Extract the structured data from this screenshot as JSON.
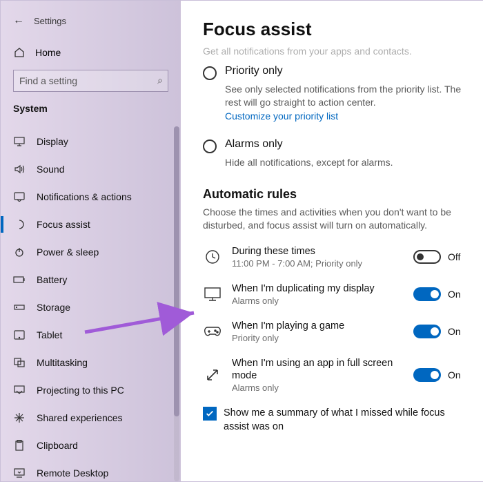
{
  "app": {
    "title": "Settings"
  },
  "sidebar": {
    "home": "Home",
    "search_placeholder": "Find a setting",
    "group": "System",
    "items": [
      {
        "label": "Display",
        "icon": "display"
      },
      {
        "label": "Sound",
        "icon": "sound"
      },
      {
        "label": "Notifications & actions",
        "icon": "notifications"
      },
      {
        "label": "Focus assist",
        "icon": "focus",
        "active": true
      },
      {
        "label": "Power & sleep",
        "icon": "power"
      },
      {
        "label": "Battery",
        "icon": "battery"
      },
      {
        "label": "Storage",
        "icon": "storage"
      },
      {
        "label": "Tablet",
        "icon": "tablet"
      },
      {
        "label": "Multitasking",
        "icon": "multitasking"
      },
      {
        "label": "Projecting to this PC",
        "icon": "projecting"
      },
      {
        "label": "Shared experiences",
        "icon": "shared"
      },
      {
        "label": "Clipboard",
        "icon": "clipboard"
      },
      {
        "label": "Remote Desktop",
        "icon": "remote"
      }
    ]
  },
  "main": {
    "heading": "Focus assist",
    "cutoff_text": "Get all notifications from your apps and contacts.",
    "radios": [
      {
        "label": "Priority only",
        "desc": "See only selected notifications from the priority list. The rest will go straight to action center.",
        "link": "Customize your priority list"
      },
      {
        "label": "Alarms only",
        "desc": "Hide all notifications, except for alarms."
      }
    ],
    "rules_heading": "Automatic rules",
    "rules_desc": "Choose the times and activities when you don't want to be disturbed, and focus assist will turn on automatically.",
    "rules": [
      {
        "title": "During these times",
        "sub": "11:00 PM - 7:00 AM; Priority only",
        "on": false,
        "state": "Off",
        "icon": "clock"
      },
      {
        "title": "When I'm duplicating my display",
        "sub": "Alarms only",
        "on": true,
        "state": "On",
        "icon": "monitor"
      },
      {
        "title": "When I'm playing a game",
        "sub": "Priority only",
        "on": true,
        "state": "On",
        "icon": "game"
      },
      {
        "title": "When I'm using an app in full screen mode",
        "sub": "Alarms only",
        "on": true,
        "state": "On",
        "icon": "fullscreen"
      }
    ],
    "summary_checkbox": {
      "checked": true,
      "label": "Show me a summary of what I missed while focus assist was on"
    }
  }
}
